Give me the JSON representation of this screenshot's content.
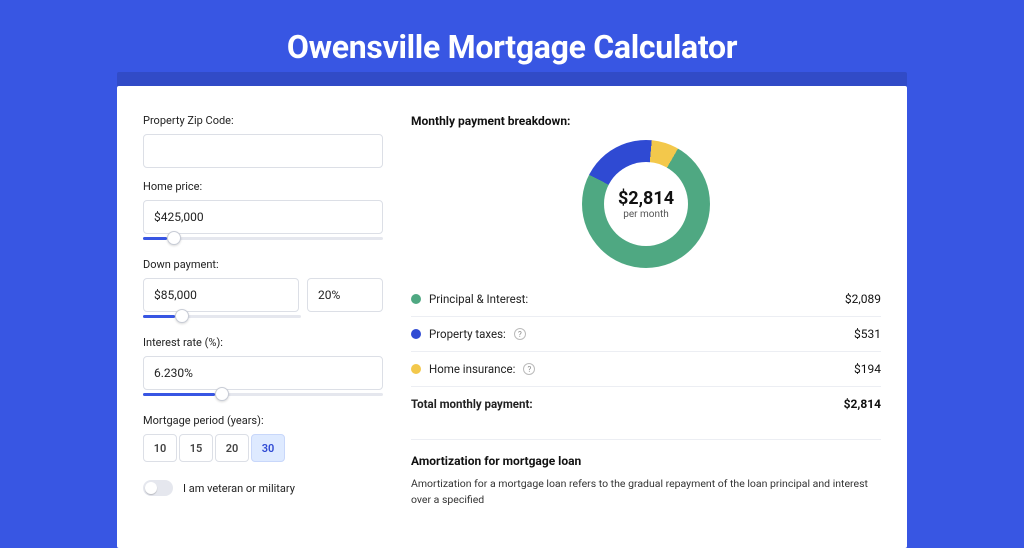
{
  "title": "Owensville Mortgage Calculator",
  "form": {
    "zip_label": "Property Zip Code:",
    "zip_value": "",
    "home_price_label": "Home price:",
    "home_price_value": "$425,000",
    "down_payment_label": "Down payment:",
    "down_payment_value": "$85,000",
    "down_payment_pct": "20%",
    "interest_label": "Interest rate (%):",
    "interest_value": "6.230%",
    "period_label": "Mortgage period (years):",
    "periods": [
      "10",
      "15",
      "20",
      "30"
    ],
    "period_selected": "30",
    "veteran_label": "I am veteran or military",
    "slider_pos": {
      "price": 10,
      "down": 20,
      "rate": 30
    }
  },
  "breakdown": {
    "header": "Monthly payment breakdown:",
    "donut_amount": "$2,814",
    "donut_sub": "per month",
    "items": [
      {
        "label": "Principal & Interest:",
        "value": "$2,089",
        "color": "#4fa882"
      },
      {
        "label": "Property taxes:",
        "value": "$531",
        "color": "#2f4ad3",
        "help": true
      },
      {
        "label": "Home insurance:",
        "value": "$194",
        "color": "#f3c84b",
        "help": true
      }
    ],
    "total_label": "Total monthly payment:",
    "total_value": "$2,814"
  },
  "chart_data": {
    "type": "pie",
    "title": "Monthly payment breakdown",
    "categories": [
      "Principal & Interest",
      "Property taxes",
      "Home insurance"
    ],
    "values": [
      2089,
      531,
      194
    ],
    "colors": [
      "#4fa882",
      "#2f4ad3",
      "#f3c84b"
    ],
    "total": 2814
  },
  "amortization": {
    "header": "Amortization for mortgage loan",
    "body": "Amortization for a mortgage loan refers to the gradual repayment of the loan principal and interest over a specified"
  }
}
